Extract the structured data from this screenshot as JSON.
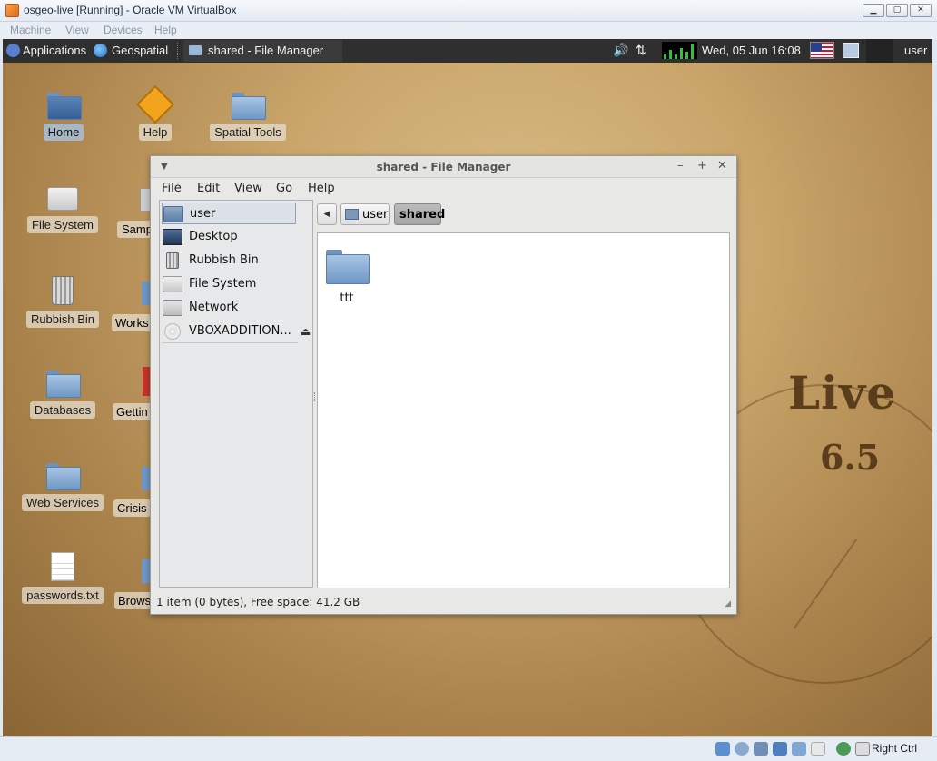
{
  "host_window": {
    "title": "osgeo-live [Running] - Oracle VM VirtualBox",
    "controls": [
      "minimize",
      "maximize",
      "close"
    ],
    "menu": [
      "Machine",
      "View",
      "Devices",
      "Help"
    ],
    "host_key_label": "Right Ctrl",
    "status_icons": [
      "hdd-icon",
      "optical-drive-icon",
      "usb-icon",
      "network-icon",
      "shared-folders-icon",
      "video-capture-icon",
      "mouse-integration-icon",
      "host-key-icon"
    ]
  },
  "guest_panel": {
    "applications": "Applications",
    "geospatial": "Geospatial",
    "task_title": "shared - File Manager",
    "clock": "Wed, 05 Jun  16:08",
    "user": "user"
  },
  "desktop_icons": [
    {
      "label": "Home"
    },
    {
      "label": "Help"
    },
    {
      "label": "Spatial Tools"
    },
    {
      "label": "File System"
    },
    {
      "label": "Samp"
    },
    {
      "label": "Rubbish Bin"
    },
    {
      "label": "Works"
    },
    {
      "label": "Databases"
    },
    {
      "label": "Gettin"
    },
    {
      "label": "Web Services"
    },
    {
      "label": "Crisis"
    },
    {
      "label": "passwords.txt"
    },
    {
      "label": "Brows"
    }
  ],
  "wallpaper": {
    "brand": "Live",
    "version": "6.5"
  },
  "file_manager": {
    "title": "shared - File Manager",
    "menu": [
      "File",
      "Edit",
      "View",
      "Go",
      "Help"
    ],
    "sidebar": [
      {
        "label": "user",
        "icon": "home-folder-icon",
        "selected": true
      },
      {
        "label": "Desktop",
        "icon": "desktop-icon"
      },
      {
        "label": "Rubbish Bin",
        "icon": "trash-icon"
      },
      {
        "label": "File System",
        "icon": "drive-icon"
      },
      {
        "label": "Network",
        "icon": "network-icon"
      },
      {
        "label": "VBOXADDITION...",
        "icon": "cd-icon"
      }
    ],
    "breadcrumb": [
      "user",
      "shared"
    ],
    "items": [
      {
        "name": "ttt",
        "type": "folder"
      }
    ],
    "status": "1 item (0 bytes), Free space: 41.2 GB"
  }
}
